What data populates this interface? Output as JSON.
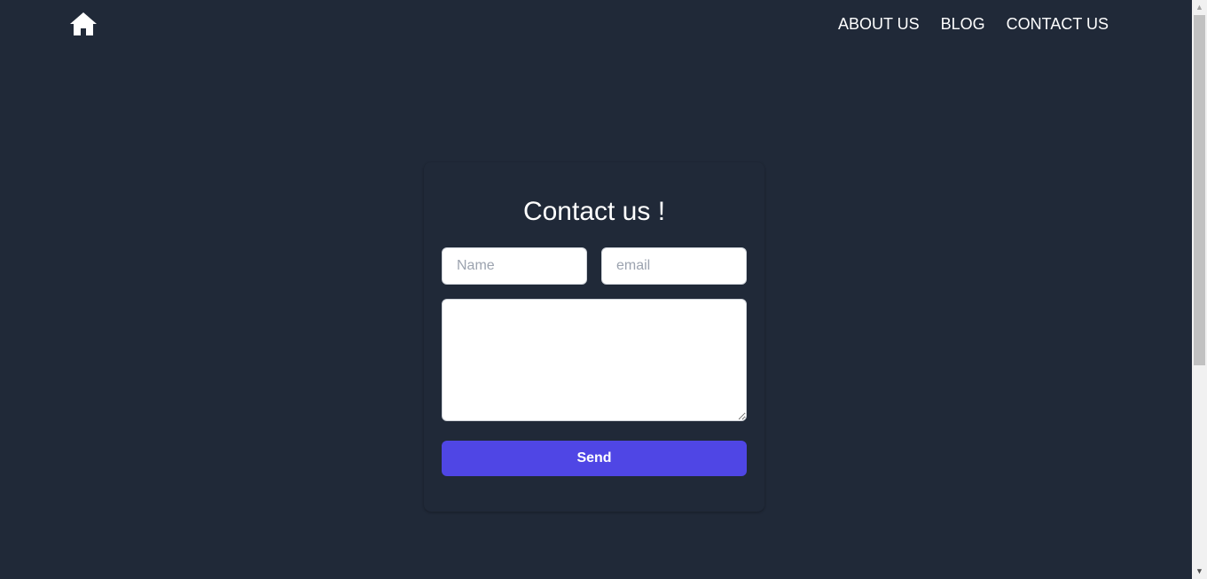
{
  "nav": {
    "home_icon": "home-icon",
    "links": [
      {
        "label": "ABOUT US"
      },
      {
        "label": "BLOG"
      },
      {
        "label": "CONTACT US"
      }
    ]
  },
  "contact": {
    "title": "Contact us !",
    "name_placeholder": "Name",
    "email_placeholder": "email",
    "message_value": "",
    "send_label": "Send"
  },
  "colors": {
    "background": "#202938",
    "accent": "#4f46e5",
    "text": "#ffffff"
  }
}
